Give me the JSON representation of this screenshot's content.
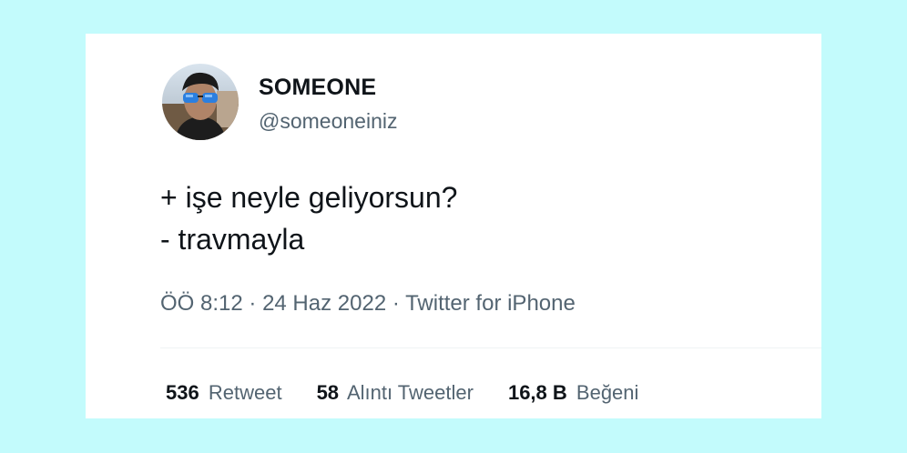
{
  "tweet": {
    "author": {
      "name": "SOMEONE",
      "handle": "@someoneiniz"
    },
    "text_lines": [
      "+ işe neyle geliyorsun?",
      "- travmayla"
    ],
    "meta": {
      "time": "ÖÖ 8:12",
      "separator": "·",
      "date": "24 Haz 2022",
      "source": "Twitter for iPhone"
    },
    "stats": [
      {
        "count": "536",
        "label": "Retweet"
      },
      {
        "count": "58",
        "label": "Alıntı Tweetler"
      },
      {
        "count": "16,8 B",
        "label": "Beğeni"
      }
    ]
  },
  "colors": {
    "background": "#c3fbfc",
    "card": "#ffffff",
    "text_primary": "#0f1419",
    "text_secondary": "#536471"
  }
}
